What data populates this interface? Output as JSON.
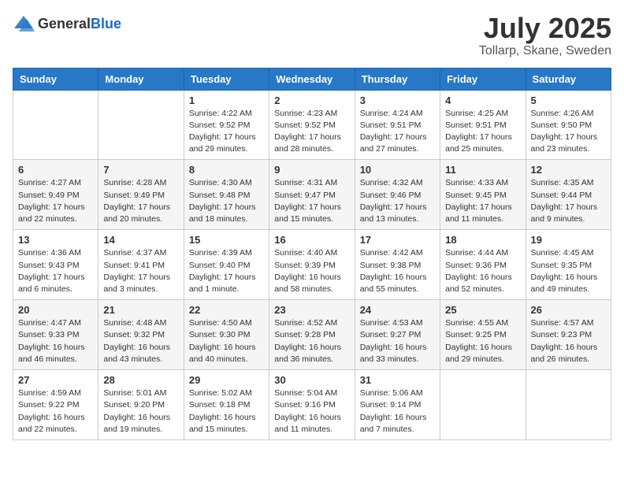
{
  "header": {
    "logo_general": "General",
    "logo_blue": "Blue",
    "month_year": "July 2025",
    "location": "Tollarp, Skane, Sweden"
  },
  "weekdays": [
    "Sunday",
    "Monday",
    "Tuesday",
    "Wednesday",
    "Thursday",
    "Friday",
    "Saturday"
  ],
  "weeks": [
    [
      {
        "day": "",
        "info": ""
      },
      {
        "day": "",
        "info": ""
      },
      {
        "day": "1",
        "info": "Sunrise: 4:22 AM\nSunset: 9:52 PM\nDaylight: 17 hours and 29 minutes."
      },
      {
        "day": "2",
        "info": "Sunrise: 4:23 AM\nSunset: 9:52 PM\nDaylight: 17 hours and 28 minutes."
      },
      {
        "day": "3",
        "info": "Sunrise: 4:24 AM\nSunset: 9:51 PM\nDaylight: 17 hours and 27 minutes."
      },
      {
        "day": "4",
        "info": "Sunrise: 4:25 AM\nSunset: 9:51 PM\nDaylight: 17 hours and 25 minutes."
      },
      {
        "day": "5",
        "info": "Sunrise: 4:26 AM\nSunset: 9:50 PM\nDaylight: 17 hours and 23 minutes."
      }
    ],
    [
      {
        "day": "6",
        "info": "Sunrise: 4:27 AM\nSunset: 9:49 PM\nDaylight: 17 hours and 22 minutes."
      },
      {
        "day": "7",
        "info": "Sunrise: 4:28 AM\nSunset: 9:49 PM\nDaylight: 17 hours and 20 minutes."
      },
      {
        "day": "8",
        "info": "Sunrise: 4:30 AM\nSunset: 9:48 PM\nDaylight: 17 hours and 18 minutes."
      },
      {
        "day": "9",
        "info": "Sunrise: 4:31 AM\nSunset: 9:47 PM\nDaylight: 17 hours and 15 minutes."
      },
      {
        "day": "10",
        "info": "Sunrise: 4:32 AM\nSunset: 9:46 PM\nDaylight: 17 hours and 13 minutes."
      },
      {
        "day": "11",
        "info": "Sunrise: 4:33 AM\nSunset: 9:45 PM\nDaylight: 17 hours and 11 minutes."
      },
      {
        "day": "12",
        "info": "Sunrise: 4:35 AM\nSunset: 9:44 PM\nDaylight: 17 hours and 9 minutes."
      }
    ],
    [
      {
        "day": "13",
        "info": "Sunrise: 4:36 AM\nSunset: 9:43 PM\nDaylight: 17 hours and 6 minutes."
      },
      {
        "day": "14",
        "info": "Sunrise: 4:37 AM\nSunset: 9:41 PM\nDaylight: 17 hours and 3 minutes."
      },
      {
        "day": "15",
        "info": "Sunrise: 4:39 AM\nSunset: 9:40 PM\nDaylight: 17 hours and 1 minute."
      },
      {
        "day": "16",
        "info": "Sunrise: 4:40 AM\nSunset: 9:39 PM\nDaylight: 16 hours and 58 minutes."
      },
      {
        "day": "17",
        "info": "Sunrise: 4:42 AM\nSunset: 9:38 PM\nDaylight: 16 hours and 55 minutes."
      },
      {
        "day": "18",
        "info": "Sunrise: 4:44 AM\nSunset: 9:36 PM\nDaylight: 16 hours and 52 minutes."
      },
      {
        "day": "19",
        "info": "Sunrise: 4:45 AM\nSunset: 9:35 PM\nDaylight: 16 hours and 49 minutes."
      }
    ],
    [
      {
        "day": "20",
        "info": "Sunrise: 4:47 AM\nSunset: 9:33 PM\nDaylight: 16 hours and 46 minutes."
      },
      {
        "day": "21",
        "info": "Sunrise: 4:48 AM\nSunset: 9:32 PM\nDaylight: 16 hours and 43 minutes."
      },
      {
        "day": "22",
        "info": "Sunrise: 4:50 AM\nSunset: 9:30 PM\nDaylight: 16 hours and 40 minutes."
      },
      {
        "day": "23",
        "info": "Sunrise: 4:52 AM\nSunset: 9:28 PM\nDaylight: 16 hours and 36 minutes."
      },
      {
        "day": "24",
        "info": "Sunrise: 4:53 AM\nSunset: 9:27 PM\nDaylight: 16 hours and 33 minutes."
      },
      {
        "day": "25",
        "info": "Sunrise: 4:55 AM\nSunset: 9:25 PM\nDaylight: 16 hours and 29 minutes."
      },
      {
        "day": "26",
        "info": "Sunrise: 4:57 AM\nSunset: 9:23 PM\nDaylight: 16 hours and 26 minutes."
      }
    ],
    [
      {
        "day": "27",
        "info": "Sunrise: 4:59 AM\nSunset: 9:22 PM\nDaylight: 16 hours and 22 minutes."
      },
      {
        "day": "28",
        "info": "Sunrise: 5:01 AM\nSunset: 9:20 PM\nDaylight: 16 hours and 19 minutes."
      },
      {
        "day": "29",
        "info": "Sunrise: 5:02 AM\nSunset: 9:18 PM\nDaylight: 16 hours and 15 minutes."
      },
      {
        "day": "30",
        "info": "Sunrise: 5:04 AM\nSunset: 9:16 PM\nDaylight: 16 hours and 11 minutes."
      },
      {
        "day": "31",
        "info": "Sunrise: 5:06 AM\nSunset: 9:14 PM\nDaylight: 16 hours and 7 minutes."
      },
      {
        "day": "",
        "info": ""
      },
      {
        "day": "",
        "info": ""
      }
    ]
  ]
}
